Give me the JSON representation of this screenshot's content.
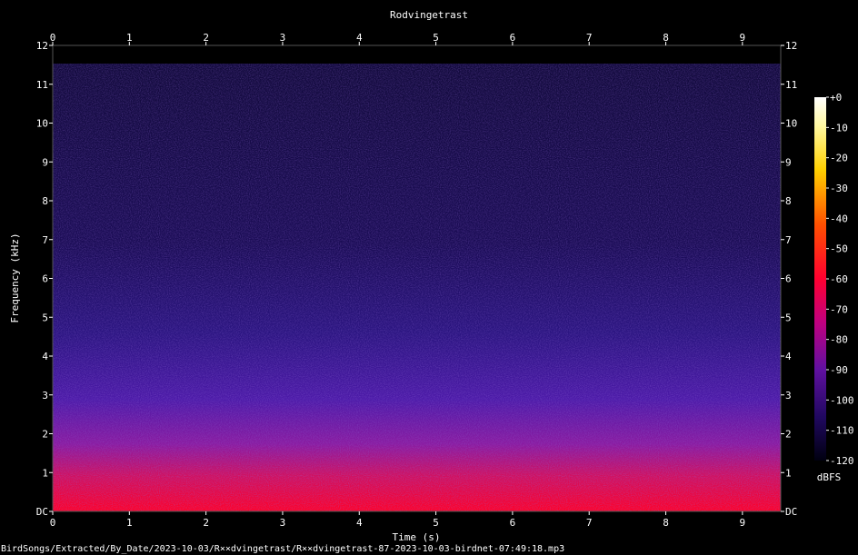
{
  "chart_data": {
    "type": "heatmap",
    "title": "Rodvingetrast",
    "xlabel": "Time (s)",
    "ylabel": "Frequency (kHz)",
    "xlim": [
      0,
      9.5
    ],
    "ylim": [
      0,
      12
    ],
    "x_ticks": [
      "0",
      "1",
      "2",
      "3",
      "4",
      "5",
      "6",
      "7",
      "8",
      "9"
    ],
    "y_ticks": [
      "DC",
      "1",
      "2",
      "3",
      "4",
      "5",
      "6",
      "7",
      "8",
      "9",
      "10",
      "11",
      "12"
    ],
    "colorbar": {
      "label": "dBFS",
      "range": [
        -120,
        0
      ],
      "ticks": [
        "+0",
        "-10",
        "-20",
        "-30",
        "-40",
        "-50",
        "-60",
        "-70",
        "-80",
        "-90",
        "-100",
        "-110",
        "-120"
      ]
    },
    "footer": "BirdSongs/Extracted/By_Date/2023-10-03/R××dvingetrast/R××dvingetrast-87-2023-10-03-birdnet-07:49:18.mp3",
    "colors": {
      "background": "#000000",
      "low": "#0a0530",
      "mid": "#3c1890",
      "high": "#ff0030",
      "peak": "#ffffff"
    }
  }
}
